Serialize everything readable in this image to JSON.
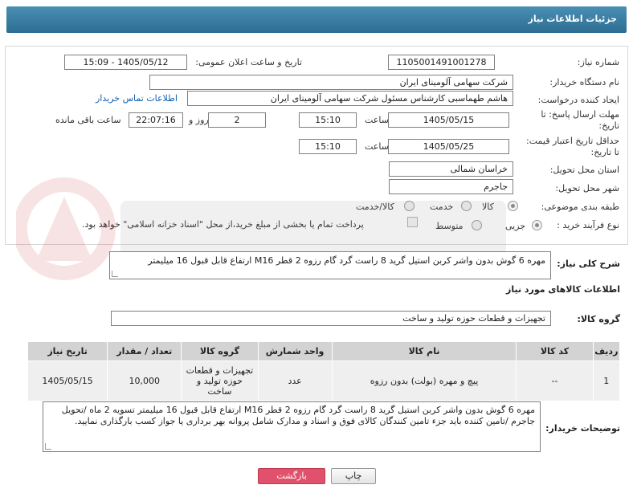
{
  "page_title": "جزئیات اطلاعات نیاز",
  "form": {
    "need_number_label": "شماره نیاز:",
    "need_number": "1105001491001278",
    "announce_label": "تاریخ و ساعت اعلان عمومی:",
    "announce_value": "1405/05/12 - 15:09",
    "buyer_org_label": "نام دستگاه خریدار:",
    "buyer_org": "شرکت سهامی آلومینای ایران",
    "creator_label": "ایجاد کننده درخواست:",
    "creator": "هاشم طهماسبی کارشناس مسئول شرکت سهامی آلومینای ایران",
    "buyer_contact_link": "اطلاعات تماس خریدار",
    "deadline_label_1": "مهلت ارسال پاسخ: تا",
    "deadline_label_2": "تاریخ:",
    "deadline_date": "1405/05/15",
    "time_label": "ساعت",
    "deadline_time": "15:10",
    "days_value": "2",
    "days_label": "روز و",
    "remaining_time": "22:07:16",
    "remaining_label": "ساعت باقی مانده",
    "price_validity_label_1": "حداقل تاریخ اعتبار قیمت:",
    "price_validity_label_2": "تا تاریخ:",
    "price_validity_date": "1405/05/25",
    "price_validity_time": "15:10",
    "province_label": "استان محل تحویل:",
    "province": "خراسان شمالی",
    "city_label": "شهر محل تحویل:",
    "city": "جاجرم",
    "category_label": "طبقه بندی موضوعی:",
    "category_options": [
      "کالا",
      "خدمت",
      "کالا/خدمت"
    ],
    "purchase_type_label": "نوع فرآیند خرید :",
    "purchase_options": [
      "جزیی",
      "متوسط"
    ],
    "payment_note": "پرداخت تمام یا بخشی از مبلغ خرید،از محل \"اسناد خزانه اسلامی\" خواهد بود."
  },
  "need_summary_label": "شرح کلی نیاز:",
  "need_summary": "مهره 6 گوش بدون واشر کربن استیل گرید 8 راست گرد گام رزوه 2 قطر M16 ارتفاع قابل قبول 16 میلیمتر",
  "goods_info_title": "اطلاعات کالاهای مورد نیاز",
  "goods_group_label": "گروه کالا:",
  "goods_group": "تجهیزات و قطعات حوزه تولید و ساخت",
  "table": {
    "headers": [
      "ردیف",
      "کد کالا",
      "نام کالا",
      "واحد شمارش",
      "گروه کالا",
      "تعداد / مقدار",
      "تاریخ نیاز"
    ],
    "rows": [
      [
        "1",
        "--",
        "پیچ و مهره (بولت) بدون رزوه",
        "عدد",
        "تجهیزات و قطعات حوزه تولید و ساخت",
        "10,000",
        "1405/05/15"
      ]
    ]
  },
  "buyer_notes_label": "توضیحات خریدار:",
  "buyer_notes": "مهره 6 گوش بدون واشر کربن استیل گرید 8 راست گرد گام رزوه 2 قطر M16 ارتفاع قابل قبول 16 میلیمتر تسویه 2 ماه /تحویل جاجرم /تامین کننده باید جزء تامین کنندگان کالای فوق و اسناد و مدارک شامل پروانه بهر برداری یا جواز کسب بارگذاری نمایید.",
  "buttons": {
    "print": "چاپ",
    "back": "بازگشت"
  },
  "colors": {
    "titlebar": "#3a7ea6",
    "link": "#1060b0",
    "back_button": "#e0526b",
    "header_cell": "#d3d3d3",
    "row_cell": "#efefef"
  }
}
